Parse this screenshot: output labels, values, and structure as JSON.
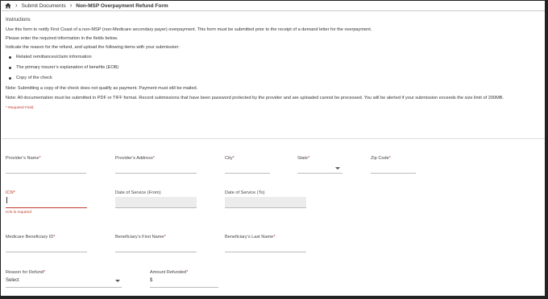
{
  "breadcrumb": {
    "home_icon": "home-icon",
    "items": [
      "Submit Documents",
      "Non-MSP Overpayment Refund Form"
    ]
  },
  "instructions": {
    "title": "Instructions",
    "p1": "Use this form to notify First Coast of a non-MSP (non-Medicare secondary payer) overpayment. This form must be submitted prior to the receipt of a demand letter for the overpayment.",
    "p2": "Please enter the required information in the fields below.",
    "p3": "Indicate the reason for the refund, and upload the following items with your submission:",
    "bullets": [
      "Related remittances/claim information",
      "The primary insurer’s explanation of benefits (EOB)",
      "Copy of the check"
    ],
    "note1": "Note: Submitting a copy of the check does not qualify as payment. Payment must still be mailed.",
    "note2": "Note: All documentation must be submitted in PDF or TIFF format. Record submissions that have been password protected by the provider and are uploaded cannot be processed. You will be alerted if your submission exceeds the size limit of 200MB.",
    "required_note": "* Required Field"
  },
  "form": {
    "providers_name": "Provider’s Name",
    "providers_address": "Provider’s Address",
    "city": "City",
    "state": "State",
    "zip": "Zip Code",
    "icn": "ICN",
    "icn_error": "ICN is required",
    "dos_from": "Date of Service (From)",
    "dos_to": "Date of Service (To)",
    "mbi": "Medicare Beneficiary ID",
    "bene_first": "Beneficiary’s First Name",
    "bene_last": "Beneficiary’s Last Name",
    "reason": "Reason for Refund",
    "reason_value": "Select",
    "amount": "Amount Refunded",
    "amount_value": "$",
    "required_mark": "*"
  },
  "colors": {
    "error": "#c0392b",
    "disabled": "#ececec"
  }
}
